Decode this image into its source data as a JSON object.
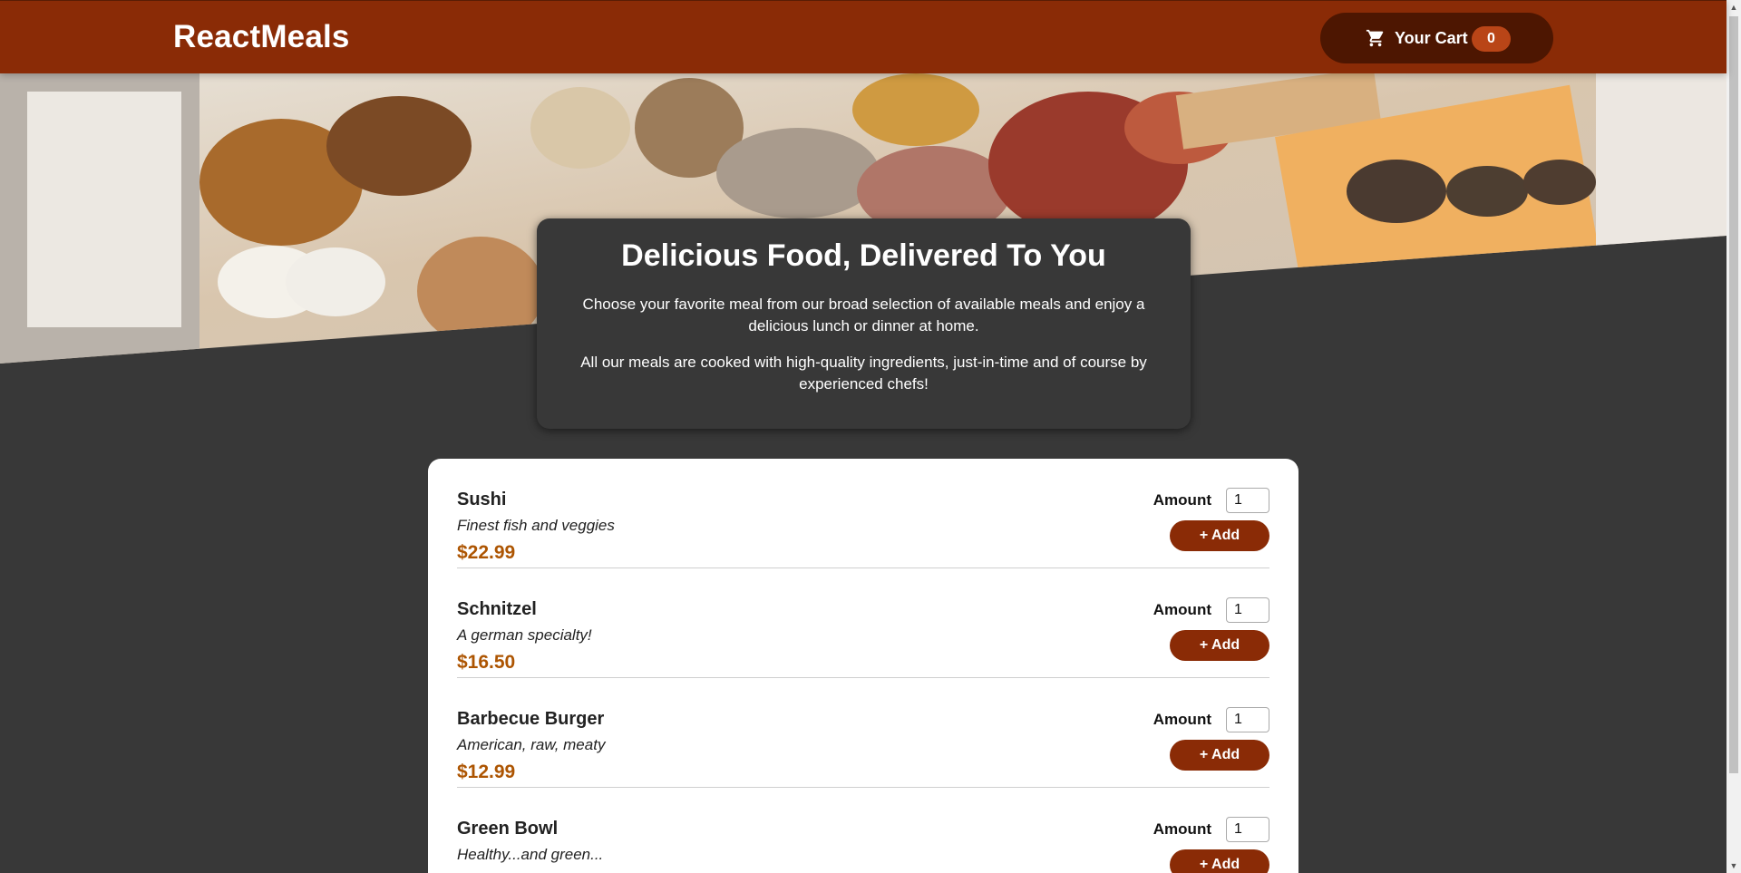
{
  "header": {
    "brand": "ReactMeals",
    "cart_label": "Your Cart",
    "cart_count": "0"
  },
  "summary": {
    "title": "Delicious Food, Delivered To You",
    "paragraph1": "Choose your favorite meal from our broad selection of available meals and enjoy a delicious lunch or dinner at home.",
    "paragraph2": "All our meals are cooked with high-quality ingredients, just-in-time and of course by experienced chefs!"
  },
  "meals": [
    {
      "name": "Sushi",
      "description": "Finest fish and veggies",
      "price": "$22.99",
      "amount_label": "Amount",
      "amount": "1",
      "add_label": "+ Add"
    },
    {
      "name": "Schnitzel",
      "description": "A german specialty!",
      "price": "$16.50",
      "amount_label": "Amount",
      "amount": "1",
      "add_label": "+ Add"
    },
    {
      "name": "Barbecue Burger",
      "description": "American, raw, meaty",
      "price": "$12.99",
      "amount_label": "Amount",
      "amount": "1",
      "add_label": "+ Add"
    },
    {
      "name": "Green Bowl",
      "description": "Healthy...and green...",
      "price": "",
      "amount_label": "Amount",
      "amount": "1",
      "add_label": "+ Add"
    }
  ],
  "colors": {
    "header": "#8a2b06",
    "cart_button": "#4d1601",
    "badge": "#b94517",
    "price": "#ad5502",
    "page_background": "#383838"
  },
  "icons": {
    "cart": "shopping-cart-icon"
  }
}
